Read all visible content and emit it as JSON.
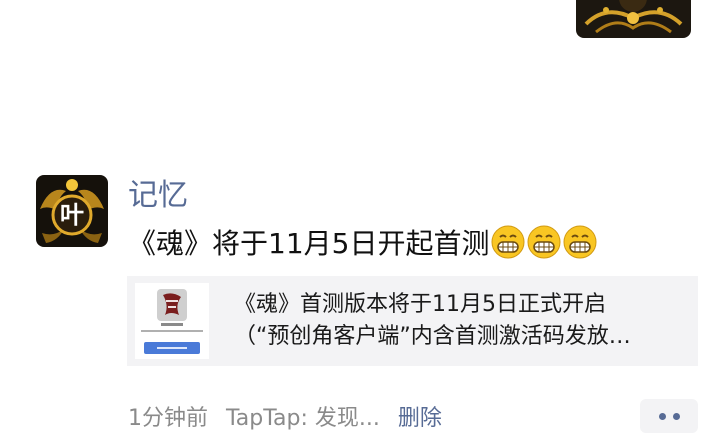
{
  "previous_post": {
    "avatar_icon": "dragon-emblem-icon"
  },
  "post": {
    "avatar": {
      "character": "叶",
      "icon": "dragon-emblem-icon"
    },
    "username": "记忆",
    "text": "《魂》将于11月5日开起首测",
    "emojis": [
      "grin-emoji-icon",
      "grin-emoji-icon",
      "grin-emoji-icon"
    ],
    "link_card": {
      "thumbnail_icon": "game-thumbnail-icon",
      "title_line1": "《魂》首测版本将于11月5日正式开启",
      "title_line2": "（“预创角客户端”内含首测激活码发放…"
    },
    "meta": {
      "time": "1分钟前",
      "source": "TapTap: 发现...",
      "delete_label": "删除"
    },
    "more_icon": "more-dots-icon"
  },
  "colors": {
    "username": "#576b95",
    "link": "#576b95",
    "meta_gray": "#8a8a8a",
    "card_bg": "#f3f3f5"
  }
}
